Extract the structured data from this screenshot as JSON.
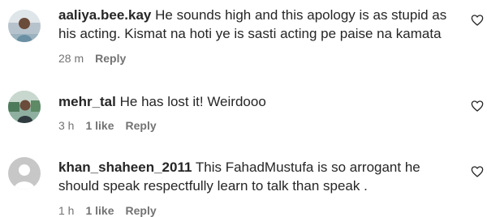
{
  "comments": [
    {
      "username": "aaliya.bee.kay",
      "text": "He sounds high and this apology is as stupid as his acting. Kismat na hoti ye is sasti acting pe paise na kamata",
      "time": "28 m",
      "likes": "",
      "reply_label": "Reply",
      "avatar_icon": "user-photo-avatar",
      "like_icon": "heart-outline-icon"
    },
    {
      "username": "mehr_tal",
      "text": "He has lost it! Weirdooo",
      "time": "3 h",
      "likes": "1 like",
      "reply_label": "Reply",
      "avatar_icon": "user-photo-avatar",
      "like_icon": "heart-outline-icon"
    },
    {
      "username": "khan_shaheen_2011",
      "text": "This FahadMustufa is so arrogant he should speak respectfully learn to talk than speak .",
      "time": "1 h",
      "likes": "1 like",
      "reply_label": "Reply",
      "avatar_icon": "default-avatar-icon",
      "like_icon": "heart-outline-icon"
    }
  ],
  "colors": {
    "text": "#262626",
    "secondary": "#737373",
    "default_avatar_bg": "#c7c7c7"
  }
}
